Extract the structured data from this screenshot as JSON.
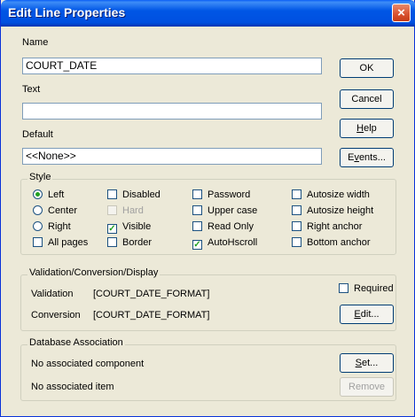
{
  "window": {
    "title": "Edit Line Properties",
    "close_glyph": "×"
  },
  "fields": {
    "name": {
      "label": "Name",
      "value": "COURT_DATE"
    },
    "text": {
      "label": "Text",
      "value": ""
    },
    "default": {
      "label": "Default",
      "value": "<<None>>",
      "arrow": "▼"
    }
  },
  "buttons": {
    "ok": "OK",
    "cancel": "Cancel",
    "help": {
      "pre": "",
      "key": "H",
      "post": "elp"
    },
    "events": {
      "pre": "E",
      "key": "v",
      "post": "ents..."
    },
    "edit": {
      "pre": "",
      "key": "E",
      "post": "dit..."
    },
    "set": {
      "pre": "",
      "key": "S",
      "post": "et..."
    },
    "remove": "Remove"
  },
  "style": {
    "label": "Style",
    "options": [
      {
        "label": "Left",
        "kind": "radio",
        "checked": true
      },
      {
        "label": "Center",
        "kind": "radio",
        "checked": false
      },
      {
        "label": "Right",
        "kind": "radio",
        "checked": false
      },
      {
        "label": "All pages",
        "kind": "check",
        "checked": false
      },
      {
        "label": "Disabled",
        "kind": "check",
        "checked": false
      },
      {
        "label": "Hard",
        "kind": "check",
        "checked": false,
        "disabled": true
      },
      {
        "label": "Visible",
        "kind": "check",
        "checked": true
      },
      {
        "label": "Border",
        "kind": "check",
        "checked": false
      },
      {
        "label": "Password",
        "kind": "check",
        "checked": false
      },
      {
        "label": "Upper case",
        "kind": "check",
        "checked": false
      },
      {
        "label": "Read Only",
        "kind": "check",
        "checked": false
      },
      {
        "label": "AutoHscroll",
        "kind": "check",
        "checked": true
      },
      {
        "label": "Autosize width",
        "kind": "check",
        "checked": false
      },
      {
        "label": "Autosize height",
        "kind": "check",
        "checked": false
      },
      {
        "label": "Right anchor",
        "kind": "check",
        "checked": false
      },
      {
        "label": "Bottom anchor",
        "kind": "check",
        "checked": false
      }
    ]
  },
  "validation": {
    "label": "Validation/Conversion/Display",
    "validation_label": "Validation",
    "validation_value": "[COURT_DATE_FORMAT]",
    "conversion_label": "Conversion",
    "conversion_value": "[COURT_DATE_FORMAT]",
    "required_label": "Required",
    "required_checked": false
  },
  "database": {
    "label": "Database Association",
    "component_text": "No associated component",
    "item_text": "No associated item"
  },
  "check_glyph": "✓"
}
